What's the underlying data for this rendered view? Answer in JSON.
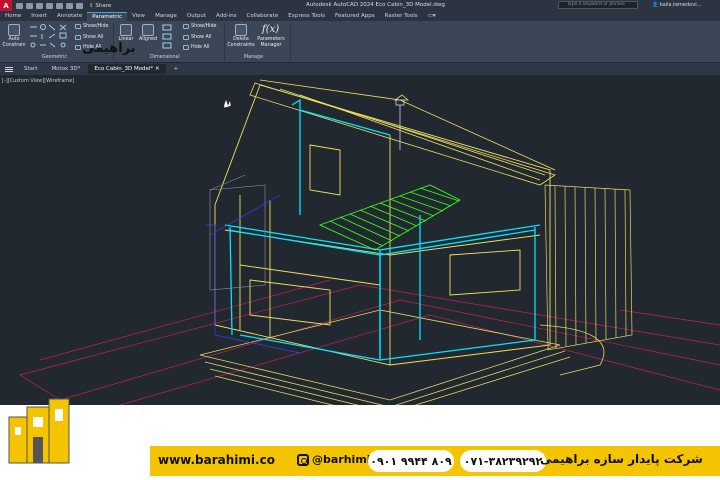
{
  "app": {
    "logo_letter": "A",
    "title": "Autodesk AutoCAD 2024   Eco Cabin_3D Model.dwg",
    "share_label": "Share",
    "search_placeholder": "Type a keyword or phrase",
    "user_name": "kaila.temedovi..."
  },
  "menu": {
    "tabs": [
      "Home",
      "Insert",
      "Annotate",
      "Parametric",
      "View",
      "Manage",
      "Output",
      "Add-ins",
      "Collaborate",
      "Express Tools",
      "Featured Apps",
      "Raster Tools"
    ],
    "active_tab": "Parametric"
  },
  "ribbon": {
    "geometric": {
      "auto_constrain": "Auto Constrain",
      "show_hide": "Show/Hide",
      "show_all": "Show All",
      "hide_all": "Hide All",
      "panel_label": "Geometric"
    },
    "dimensional": {
      "linear": "Linear",
      "aligned": "Aligned",
      "show_hide": "Show/Hide",
      "show_all": "Show All",
      "hide_all": "Hide All",
      "panel_label": "Dimensional"
    },
    "manage": {
      "delete_constraints": "Delete Constraints",
      "parameters_manager": "Parameters Manager",
      "fx_symbol": "f(x)",
      "panel_label": "Manage"
    }
  },
  "doc_tabs": {
    "start": "Start",
    "tab2": "Motox 3D*",
    "tab3": "Eco Cabin_3D Model*",
    "add": "+"
  },
  "viewport": {
    "view_label": "[-][Custom View][Wireframe]"
  },
  "footer": {
    "brand_name": "براهیمی",
    "brand_sub": "شرکت پایدار سازه",
    "website": "www.barahimi.co",
    "instagram": "@barhimico",
    "phone_mobile": "۰۹۰۱ ۹۹۴۴ ۸۰۹",
    "phone_office": "۰۷۱-۳۸۲۳۹۲۹۲",
    "company_name": "شرکت پایدار سازه براهیمی"
  },
  "colors": {
    "autocad_red": "#c8102e",
    "wire_cyan": "#00e5ff",
    "wire_yellow": "#f0e060",
    "wire_green": "#39ff14",
    "wire_magenta": "#d0205a",
    "wire_blue": "#3040ff",
    "brand_yellow": "#f5c400"
  }
}
